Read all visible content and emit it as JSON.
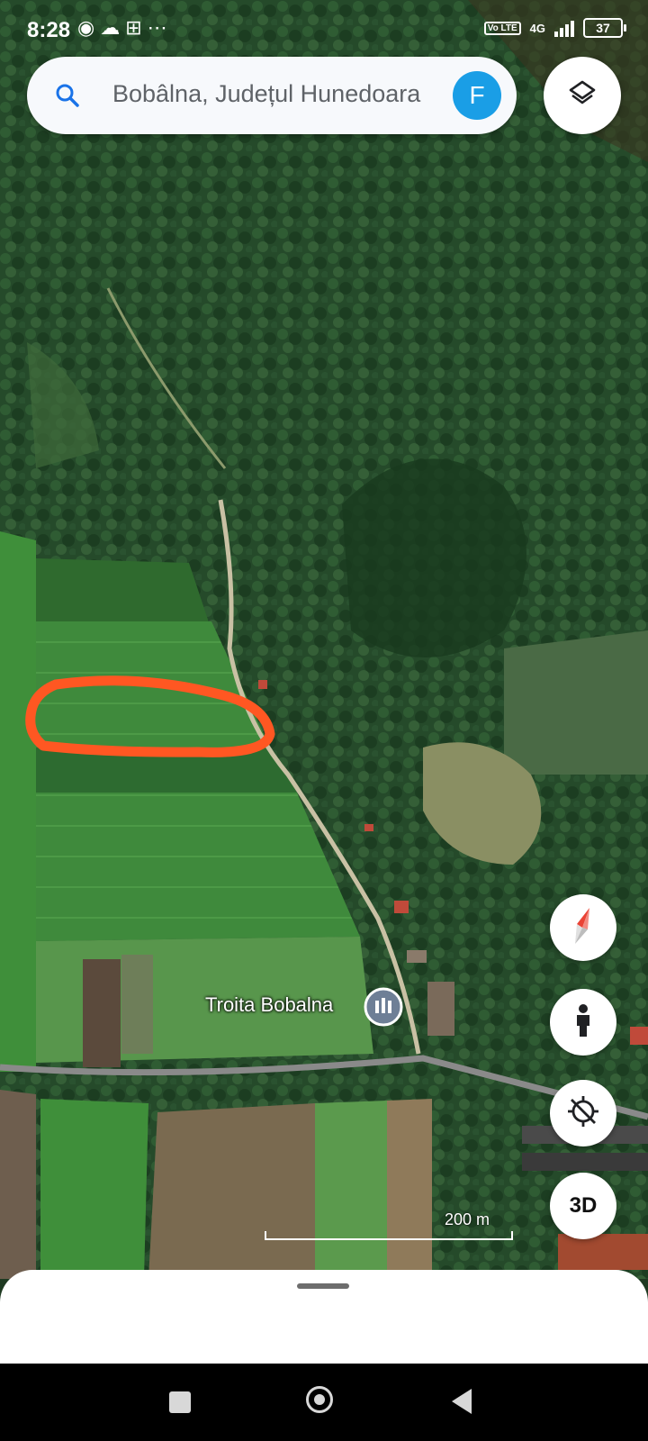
{
  "status_bar": {
    "time": "8:28",
    "left_icons": [
      "messenger-icon",
      "cloud-icon",
      "gamepad-icon",
      "more-dots-icon"
    ],
    "volte": "Vo LTE",
    "network": "4G",
    "battery": "37"
  },
  "search": {
    "query": "Bobâlna, Județul Hunedoara",
    "account_initial": "F",
    "account_color": "#1a9ee6"
  },
  "map": {
    "type": "satellite",
    "place_label": "Troita Bobalna",
    "place_icon": "landmark-pin-icon",
    "scale_label": "200 m",
    "annotation_color": "#ff5722"
  },
  "controls": {
    "layers": "layers-icon",
    "compass": "compass-icon",
    "street_view": "pegman-icon",
    "my_location": "location-disabled-icon",
    "three_d_label": "3D"
  },
  "nav_bar": [
    "recents-button",
    "home-button",
    "back-button"
  ]
}
